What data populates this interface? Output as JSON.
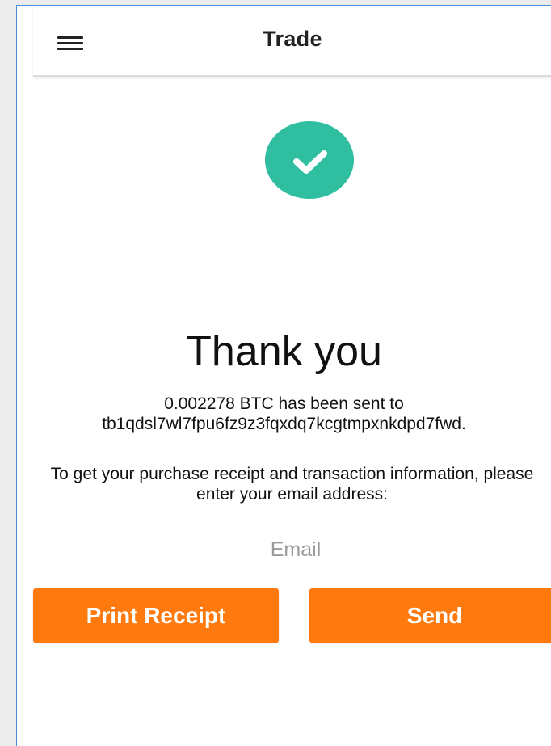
{
  "header": {
    "title": "Trade",
    "menu_icon": "hamburger-menu-icon"
  },
  "status": {
    "icon": "checkmark-icon",
    "badge_color": "#2fbfa0"
  },
  "content": {
    "heading": "Thank you",
    "sent_line": "0.002278 BTC has been sent to",
    "address": "tb1qdsl7wl7fpu6fz9z3fqxdq7kcgtmpxnkdpd7fwd.",
    "receipt_prompt": "To get your purchase receipt and transaction information, please enter your email address:"
  },
  "email": {
    "placeholder": "Email",
    "value": ""
  },
  "actions": {
    "print_label": "Print Receipt",
    "send_label": "Send",
    "button_color": "#ff7a0e"
  }
}
